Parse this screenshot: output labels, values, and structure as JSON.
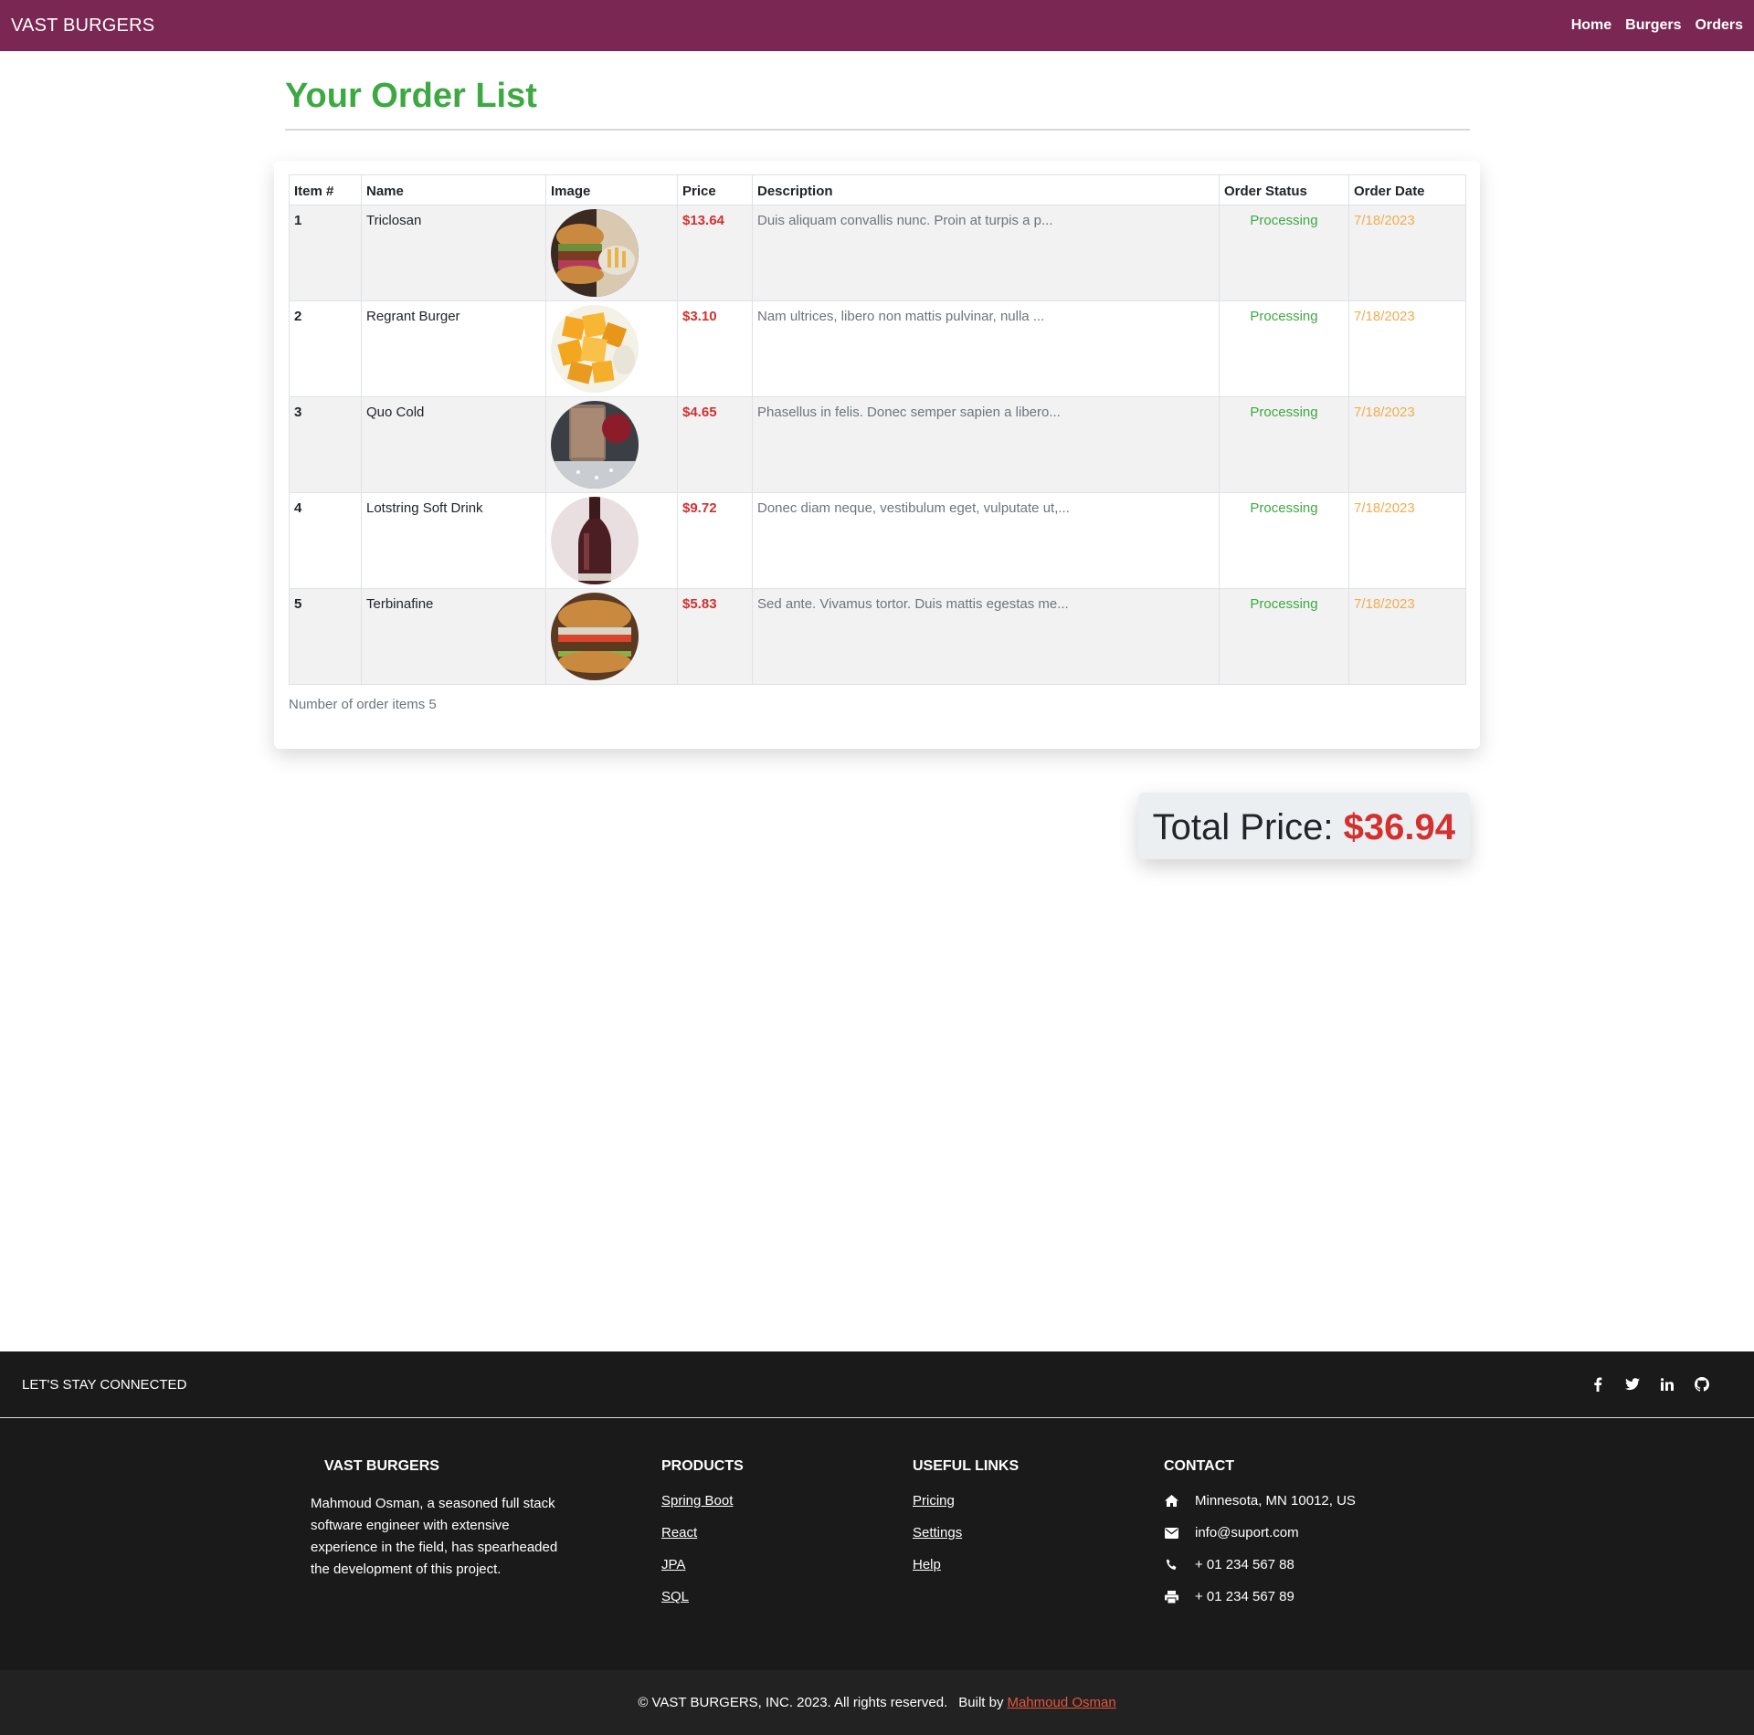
{
  "navbar": {
    "brand": "VAST BURGERS",
    "links": [
      "Home",
      "Burgers",
      "Orders"
    ]
  },
  "page": {
    "title": "Your Order List"
  },
  "table": {
    "headers": [
      "Item #",
      "Name",
      "Image",
      "Price",
      "Description",
      "Order Status",
      "Order Date"
    ],
    "rows": [
      {
        "num": "1",
        "name": "Triclosan",
        "image": "burger-and-fries-photo",
        "price": "$13.64",
        "description": "Duis aliquam convallis nunc. Proin at turpis a p...",
        "status": "Processing",
        "date": "7/18/2023"
      },
      {
        "num": "2",
        "name": "Regrant Burger",
        "image": "mango-pieces-photo",
        "price": "$3.10",
        "description": "Nam ultrices, libero non mattis pulvinar, nulla ...",
        "status": "Processing",
        "date": "7/18/2023"
      },
      {
        "num": "3",
        "name": "Quo Cold",
        "image": "cold-drink-photo",
        "price": "$4.65",
        "description": "Phasellus in felis. Donec semper sapien a libero...",
        "status": "Processing",
        "date": "7/18/2023"
      },
      {
        "num": "4",
        "name": "Lotstring Soft Drink",
        "image": "soda-bottle-photo",
        "price": "$9.72",
        "description": "Donec diam neque, vestibulum eget, vulputate ut,...",
        "status": "Processing",
        "date": "7/18/2023"
      },
      {
        "num": "5",
        "name": "Terbinafine",
        "image": "burger-photo",
        "price": "$5.83",
        "description": "Sed ante. Vivamus tortor. Duis mattis egestas me...",
        "status": "Processing",
        "date": "7/18/2023"
      }
    ],
    "count_text": "Number of order items 5"
  },
  "total": {
    "label": "Total Price:",
    "value": "$36.94"
  },
  "footer": {
    "social_title": "LET'S STAY CONNECTED",
    "social_icons": [
      "facebook-icon",
      "twitter-icon",
      "linkedin-icon",
      "github-icon"
    ],
    "about": {
      "heading": "VAST BURGERS",
      "text": "Mahmoud Osman, a seasoned full stack software engineer with extensive experience in the field, has spearheaded the development of this project."
    },
    "products": {
      "heading": "PRODUCTS",
      "links": [
        "Spring Boot",
        "React",
        "JPA",
        "SQL"
      ]
    },
    "useful_links": {
      "heading": "USEFUL LINKS",
      "links": [
        "Pricing",
        "Settings",
        "Help"
      ]
    },
    "contact": {
      "heading": "CONTACT",
      "address": "Minnesota, MN 10012, US",
      "email": "info@suport.com",
      "phone": "+ 01 234 567 88",
      "fax": "+ 01 234 567 89"
    },
    "copyright": "© VAST BURGERS, INC. 2023. All rights reserved.",
    "built_by_label": "Built by",
    "author": "Mahmoud Osman"
  },
  "colors": {
    "navbar": "#7a2753",
    "title_green": "#3ea843",
    "price_red": "#d33030",
    "date_orange": "#f0ad4e",
    "footer_bg": "#1a1a1a",
    "author_link": "#e8553a"
  }
}
